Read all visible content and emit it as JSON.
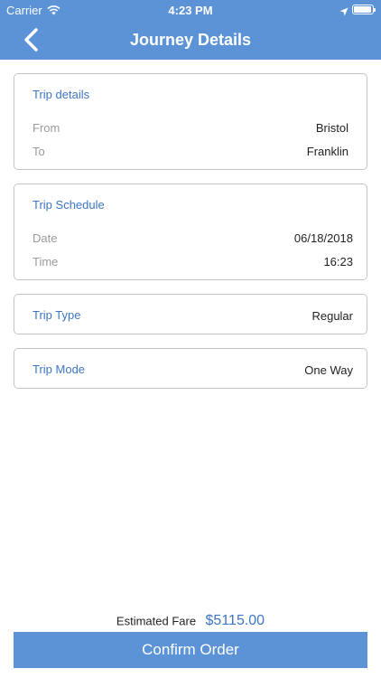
{
  "status_bar": {
    "carrier": "Carrier",
    "time": "4:23 PM",
    "icons": [
      "wifi-icon",
      "location-arrow-icon",
      "battery-icon"
    ]
  },
  "nav": {
    "title": "Journey Details",
    "back_icon": "chevron-left-icon"
  },
  "trip_details": {
    "title": "Trip details",
    "from_label": "From",
    "from_value": "Bristol",
    "to_label": "To",
    "to_value": "Franklin"
  },
  "trip_schedule": {
    "title": "Trip Schedule",
    "date_label": "Date",
    "date_value": "06/18/2018",
    "time_label": "Time",
    "time_value": "16:23"
  },
  "trip_type": {
    "label": "Trip Type",
    "value": "Regular"
  },
  "trip_mode": {
    "label": "Trip Mode",
    "value": "One Way"
  },
  "footer": {
    "fare_label": "Estimated Fare",
    "fare_value": "$5115.00",
    "confirm_label": "Confirm Order"
  },
  "colors": {
    "header": "#5b93d6",
    "accent_text": "#3e76c3",
    "border": "#c4c4c4",
    "muted_text": "#9a9a9a"
  }
}
